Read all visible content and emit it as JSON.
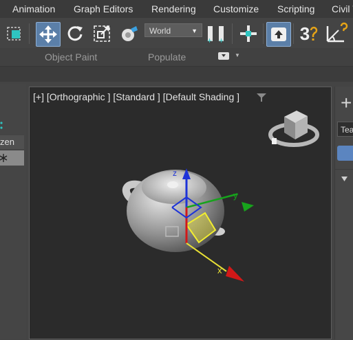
{
  "menu": {
    "items": [
      {
        "id": "animation",
        "label": "Animation"
      },
      {
        "id": "graph-editors",
        "label": "Graph Editors"
      },
      {
        "id": "rendering",
        "label": "Rendering"
      },
      {
        "id": "customize",
        "label": "Customize"
      },
      {
        "id": "scripting",
        "label": "Scripting"
      },
      {
        "id": "civil-view",
        "label": "Civil V"
      }
    ]
  },
  "toolbar": {
    "reference_coordinate_system": "World",
    "snap_toggle_label": "3",
    "icons": [
      "select-region-icon",
      "select-move-icon",
      "rotate-icon",
      "scale-icon",
      "cube-paint-icon",
      "snap-toggle-icon",
      "angle-snap-icon"
    ]
  },
  "ribbon": {
    "tabs": [
      "Object Paint",
      "Populate"
    ]
  },
  "left_panel": {
    "column_header": "zen"
  },
  "viewport": {
    "label": "[+] [Orthographic ] [Standard ] [Default Shading ]",
    "gizmo_axes": {
      "x": "x",
      "y": "y",
      "z": "z"
    },
    "colors": {
      "x": "#d21818",
      "y": "#17a31c",
      "z": "#1d33d8",
      "plane": "#e8e035"
    }
  },
  "right_panel": {
    "name_field_value": "Tea",
    "plus_label": "+"
  }
}
